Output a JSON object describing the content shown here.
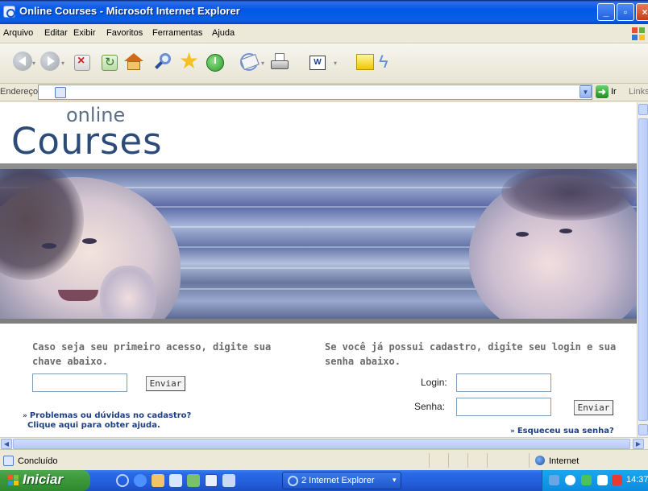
{
  "window": {
    "title": "Online Courses - Microsoft Internet Explorer",
    "controls": [
      "minimize",
      "maximize",
      "close"
    ]
  },
  "menubar": {
    "items": [
      "Arquivo",
      "Editar",
      "Exibir",
      "Favoritos",
      "Ferramentas",
      "Ajuda"
    ]
  },
  "toolbar": {
    "icons": [
      "back-icon",
      "forward-icon",
      "stop-icon",
      "refresh-icon",
      "home-icon",
      "search-icon",
      "favorites-icon",
      "history-icon",
      "mail-icon",
      "print-icon",
      "word-icon",
      "note-icon",
      "messenger-icon"
    ],
    "word_glyph": "W"
  },
  "addressbar": {
    "label": "Endereço",
    "value": "",
    "go_label": "Ir",
    "links_label": "Links"
  },
  "page": {
    "logo_small": "online",
    "logo_large": "Courses",
    "first_access_text": "Caso seja seu primeiro acesso, digite sua chave abaixo.",
    "registered_text": "Se você já possui cadastro, digite seu login e sua senha abaixo.",
    "send_button_1": "Enviar",
    "login_label": "Login:",
    "password_label": "Senha:",
    "send_button_2": "Enviar",
    "help_line1": "Problemas ou dúvidas no cadastro?",
    "help_line2": "Clique aqui para obter ajuda.",
    "forgot_link": "Esqueceu sua senha?"
  },
  "statusbar": {
    "text": "Concluído",
    "zone": "Internet"
  },
  "taskbar": {
    "start_label": "Iniciar",
    "task_label": "2 Internet Explorer",
    "clock": "14:37"
  },
  "colors": {
    "title_bar": "#0058e6",
    "logo_blue": "#2c4b78",
    "link_blue": "#1e3f82",
    "start_green": "#3c9a3c",
    "taskbar_blue": "#245edb"
  }
}
